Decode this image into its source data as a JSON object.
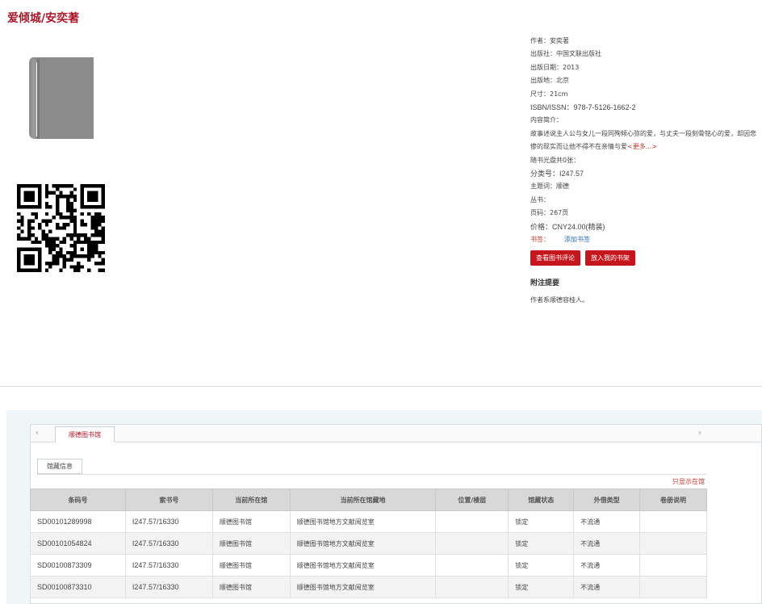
{
  "title": "爱倾城/安奕著",
  "info": {
    "author": "作者：安奕著",
    "publisher": "出版社：中国文联出版社",
    "pub_date": "出版日期：2013",
    "pub_place": "出版地：北京",
    "size": "尺寸：21cm",
    "isbn": "ISBN/ISSN：978-7-5126-1662-2",
    "summary_label": "内容简介：",
    "summary_text": "故事述说主人公与女儿一段同殉倾心弥的爱，与丈夫一段刻骨铭心的爱，却因悲惨的现实而让他不得不在亲情与爱",
    "more": "<更多...>",
    "attachments": "随书光盘共0张：",
    "classification": "分类号：I247.57",
    "subject": "主题词：顺德",
    "series": "丛书：",
    "pages": "页码：267页",
    "price": "价格：CNY24.00(精装)",
    "tags_label": "书签：",
    "add_tag": "添加书签"
  },
  "buttons": {
    "view_reviews": "查看图书评论",
    "add_to_shelf": "放入我的书架"
  },
  "notes": {
    "heading": "附注提要",
    "text": "作者系顺德容桂人。"
  },
  "library_tab": "顺德图书馆",
  "sub_tab": "馆藏信息",
  "only_show": "只显示在馆",
  "table": {
    "headers": [
      "条码号",
      "索书号",
      "当前所在馆",
      "当前所在馆藏地",
      "位置/楼层",
      "馆藏状态",
      "外借类型",
      "卷册说明"
    ],
    "rows": [
      [
        "SD00101289998",
        "I247.57/16330",
        "顺德图书馆",
        "顺德图书馆地方文献阅览室",
        "",
        "锁定",
        "不流通",
        ""
      ],
      [
        "SD00101054824",
        "I247.57/16330",
        "顺德图书馆",
        "顺德图书馆地方文献阅览室",
        "",
        "锁定",
        "不流通",
        ""
      ],
      [
        "SD00100873309",
        "I247.57/16330",
        "顺德图书馆",
        "顺德图书馆地方文献阅览室",
        "",
        "锁定",
        "不流通",
        ""
      ],
      [
        "SD00100873310",
        "I247.57/16330",
        "顺德图书馆",
        "顺德图书馆地方文献阅览室",
        "",
        "锁定",
        "不流通",
        ""
      ]
    ]
  },
  "icons": {
    "cover": "book-icon",
    "qr": "qr-code-icon",
    "tab_prev": "chevron-left-icon",
    "tab_next": "chevron-right-icon"
  },
  "colors": {
    "accent": "#a8182a",
    "button": "#c4161c",
    "link": "#2a6fb0"
  }
}
